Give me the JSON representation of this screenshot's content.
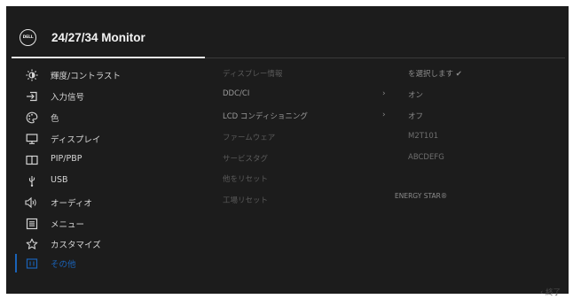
{
  "header": {
    "logo_text": "DELL",
    "title": "24/27/34 Monitor"
  },
  "menu": {
    "items": [
      {
        "label": "輝度/コントラスト",
        "icon": "brightness-icon"
      },
      {
        "label": "入力信号",
        "icon": "input-source-icon"
      },
      {
        "label": "色",
        "icon": "color-palette-icon"
      },
      {
        "label": "ディスプレイ",
        "icon": "display-icon"
      },
      {
        "label": "PIP/PBP",
        "icon": "pip-pbp-icon"
      },
      {
        "label": "USB",
        "icon": "usb-icon"
      },
      {
        "label": "オーディオ",
        "icon": "speaker-icon"
      },
      {
        "label": "メニュー",
        "icon": "menu-icon"
      },
      {
        "label": "カスタマイズ",
        "icon": "star-icon"
      },
      {
        "label": "その他",
        "icon": "others-icon"
      }
    ],
    "active_index": 9
  },
  "submenu": {
    "items": [
      "ディスプレー情報",
      "DDC/CI",
      "LCD コンディショニング",
      "ファームウェア",
      "サービスタグ",
      "他をリセット",
      "工場リセット"
    ]
  },
  "values": {
    "select": "を選択します ✔",
    "ddc": "オン",
    "lcd": "オフ",
    "firmware": "M2T101",
    "service_tag": "ABCDEFG",
    "energy_star": "ENERGY STAR®"
  },
  "footer": {
    "exit": "‹ 終了"
  },
  "colors": {
    "accent": "#1a63b8",
    "background": "#1c1c1c"
  }
}
